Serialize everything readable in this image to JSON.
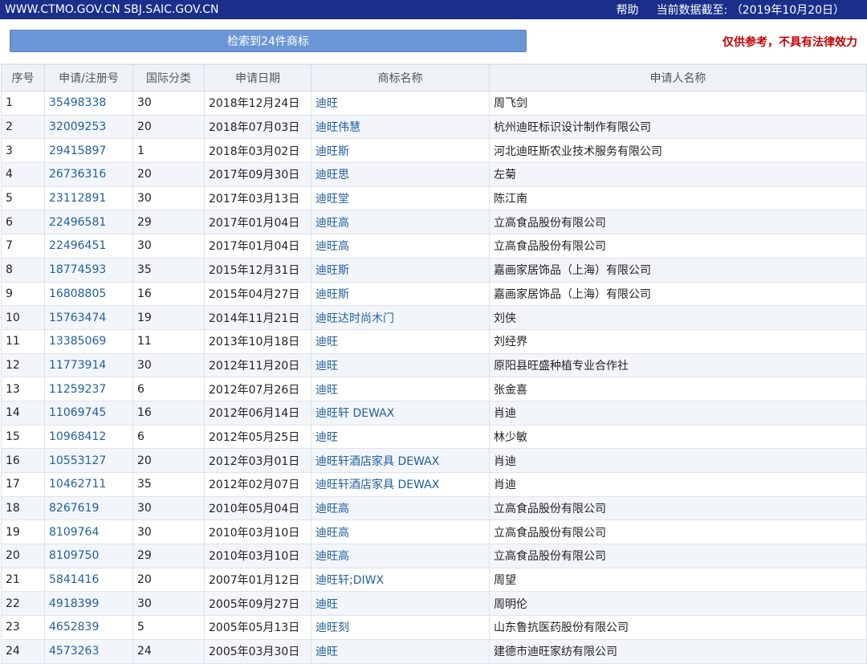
{
  "header": {
    "site": "WWW.CTMO.GOV.CN SBJ.SAIC.GOV.CN",
    "help": "帮助",
    "date_prefix": "当前数据截至:",
    "date": "（2019年10月20日）"
  },
  "result": {
    "label": "检索到24件商标",
    "disclaimer": "仅供参考，不具有法律效力"
  },
  "columns": [
    "序号",
    "申请/注册号",
    "国际分类",
    "申请日期",
    "商标名称",
    "申请人名称"
  ],
  "rows": [
    [
      "1",
      "35498338",
      "30",
      "2018年12月24日",
      "迪旺",
      "周飞剑"
    ],
    [
      "2",
      "32009253",
      "20",
      "2018年07月03日",
      "迪旺伟慧",
      "杭州迪旺标识设计制作有限公司"
    ],
    [
      "3",
      "29415897",
      "1",
      "2018年03月02日",
      "迪旺斯",
      "河北迪旺斯农业技术服务有限公司"
    ],
    [
      "4",
      "26736316",
      "20",
      "2017年09月30日",
      "迪旺思",
      "左菊"
    ],
    [
      "5",
      "23112891",
      "30",
      "2017年03月13日",
      "迪旺堂",
      "陈江南"
    ],
    [
      "6",
      "22496581",
      "29",
      "2017年01月04日",
      "迪旺高",
      "立高食品股份有限公司"
    ],
    [
      "7",
      "22496451",
      "30",
      "2017年01月04日",
      "迪旺高",
      "立高食品股份有限公司"
    ],
    [
      "8",
      "18774593",
      "35",
      "2015年12月31日",
      "迪旺斯",
      "嘉画家居饰品（上海）有限公司"
    ],
    [
      "9",
      "16808805",
      "16",
      "2015年04月27日",
      "迪旺斯",
      "嘉画家居饰品（上海）有限公司"
    ],
    [
      "10",
      "15763474",
      "19",
      "2014年11月21日",
      "迪旺达时尚木门",
      "刘侠"
    ],
    [
      "11",
      "13385069",
      "11",
      "2013年10月18日",
      "迪旺",
      "刘经界"
    ],
    [
      "12",
      "11773914",
      "30",
      "2012年11月20日",
      "迪旺",
      "原阳县旺盛种植专业合作社"
    ],
    [
      "13",
      "11259237",
      "6",
      "2012年07月26日",
      "迪旺",
      "张金喜"
    ],
    [
      "14",
      "11069745",
      "16",
      "2012年06月14日",
      "迪旺轩 DEWAX",
      "肖迪"
    ],
    [
      "15",
      "10968412",
      "6",
      "2012年05月25日",
      "迪旺",
      "林少敏"
    ],
    [
      "16",
      "10553127",
      "20",
      "2012年03月01日",
      "迪旺轩酒店家具 DEWAX",
      "肖迪"
    ],
    [
      "17",
      "10462711",
      "35",
      "2012年02月07日",
      "迪旺轩酒店家具 DEWAX",
      "肖迪"
    ],
    [
      "18",
      "8267619",
      "30",
      "2010年05月04日",
      "迪旺高",
      "立高食品股份有限公司"
    ],
    [
      "19",
      "8109764",
      "30",
      "2010年03月10日",
      "迪旺高",
      "立高食品股份有限公司"
    ],
    [
      "20",
      "8109750",
      "29",
      "2010年03月10日",
      "迪旺高",
      "立高食品股份有限公司"
    ],
    [
      "21",
      "5841416",
      "20",
      "2007年01月12日",
      "迪旺轩;DIWX",
      "周望"
    ],
    [
      "22",
      "4918399",
      "30",
      "2005年09月27日",
      "迪旺",
      "周明伦"
    ],
    [
      "23",
      "4652839",
      "5",
      "2005年05月13日",
      "迪旺刻",
      "山东鲁抗医药股份有限公司"
    ],
    [
      "24",
      "4573263",
      "24",
      "2005年03月30日",
      "迪旺",
      "建德市迪旺家纺有限公司"
    ]
  ],
  "colors": {
    "topbar": "#1a2f8a",
    "button": "#6b96d6",
    "link": "#1f5fa0",
    "disclaimer": "#c00000",
    "row_alt": "#f2f6fa"
  }
}
